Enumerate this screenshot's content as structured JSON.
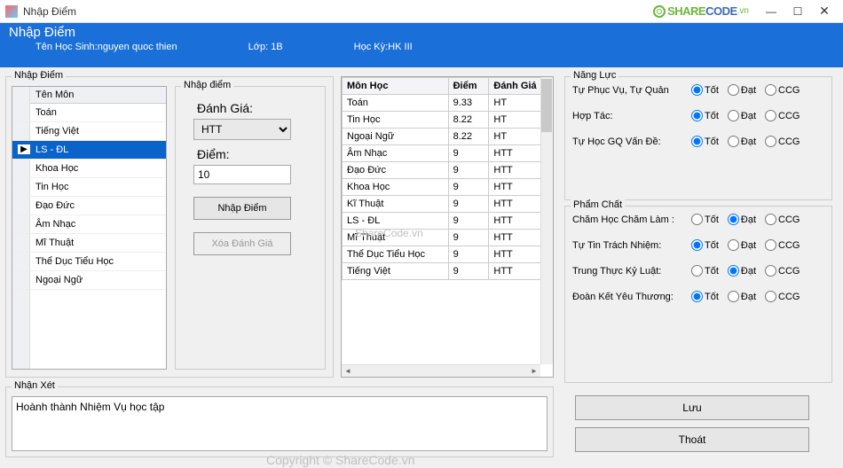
{
  "window": {
    "title": "Nhập Điểm",
    "minimize": "—",
    "maximize": "☐",
    "close": "✕"
  },
  "brand": {
    "p1": "SHARE",
    "p2": "CODE",
    "p3": ".vn"
  },
  "header": {
    "title": "Nhập Điểm",
    "student_label": "Tên Học Sinh:",
    "student_name": "nguyen quoc thien",
    "class_label": "Lớp: ",
    "class_value": "1B",
    "semester_label": "Học Kỳ:",
    "semester_value": "HK III"
  },
  "group_left": {
    "title": "Nhập Điểm"
  },
  "subject_header": "Tên Môn",
  "subjects": [
    "Toán",
    "Tiếng Việt",
    "LS - ĐL",
    "Khoa Học",
    "Tin Học",
    "Đạo Đức",
    "Âm Nhạc",
    "Mĩ Thuật",
    "Thể Dục Tiểu Học",
    "Ngoại Ngữ"
  ],
  "selected_subject_index": 2,
  "entry": {
    "title": "Nhập điểm",
    "rating_label": "Đánh Giá:",
    "rating_value": "HTT",
    "score_label": "Điểm:",
    "score_value": "10",
    "btn_enter": "Nhập Điểm",
    "btn_delete": "Xóa Đánh Giá"
  },
  "scores_headers": [
    "Môn Học",
    "Điểm",
    "Đánh Giá"
  ],
  "scores": [
    {
      "mon": "Toán",
      "diem": "9.33",
      "dg": "HT"
    },
    {
      "mon": "Tin Học",
      "diem": "8.22",
      "dg": "HT"
    },
    {
      "mon": "Ngoại Ngữ",
      "diem": "8.22",
      "dg": "HT"
    },
    {
      "mon": "Âm Nhạc",
      "diem": "9",
      "dg": "HTT"
    },
    {
      "mon": "Đạo Đức",
      "diem": "9",
      "dg": "HTT"
    },
    {
      "mon": "Khoa Học",
      "diem": "9",
      "dg": "HTT"
    },
    {
      "mon": "Kĩ Thuật",
      "diem": "9",
      "dg": "HTT"
    },
    {
      "mon": "LS - ĐL",
      "diem": "9",
      "dg": "HTT"
    },
    {
      "mon": "Mĩ Thuật",
      "diem": "9",
      "dg": "HTT"
    },
    {
      "mon": "Thể Dục Tiểu Học",
      "diem": "9",
      "dg": "HTT"
    },
    {
      "mon": "Tiếng Việt",
      "diem": "9",
      "dg": "HTT"
    }
  ],
  "nangluc": {
    "title": "Năng Lực",
    "opts": [
      "Tốt",
      "Đạt",
      "CCG"
    ],
    "rows": [
      {
        "label": "Tự Phục Vụ, Tự Quản",
        "sel": 0
      },
      {
        "label": "Hợp Tác:",
        "sel": 0
      },
      {
        "label": "Tự Học GQ Vấn Đề:",
        "sel": 0
      }
    ]
  },
  "phamchat": {
    "title": "Phẩm Chất",
    "opts": [
      "Tốt",
      "Đạt",
      "CCG"
    ],
    "rows": [
      {
        "label": "Chăm Học Chăm Làm :",
        "sel": 1
      },
      {
        "label": "Tự Tin Trách Nhiệm:",
        "sel": 0
      },
      {
        "label": "Trung Thực Kỷ Luật:",
        "sel": 1
      },
      {
        "label": "Đoàn Kết Yêu Thương:",
        "sel": 0
      }
    ]
  },
  "comment": {
    "title": "Nhận Xét",
    "value": "Hoành thành Nhiệm Vụ học tập"
  },
  "buttons": {
    "save": "Lưu",
    "exit": "Thoát"
  },
  "watermark": "ShareCode.vn",
  "copyright": "Copyright © ShareCode.vn"
}
